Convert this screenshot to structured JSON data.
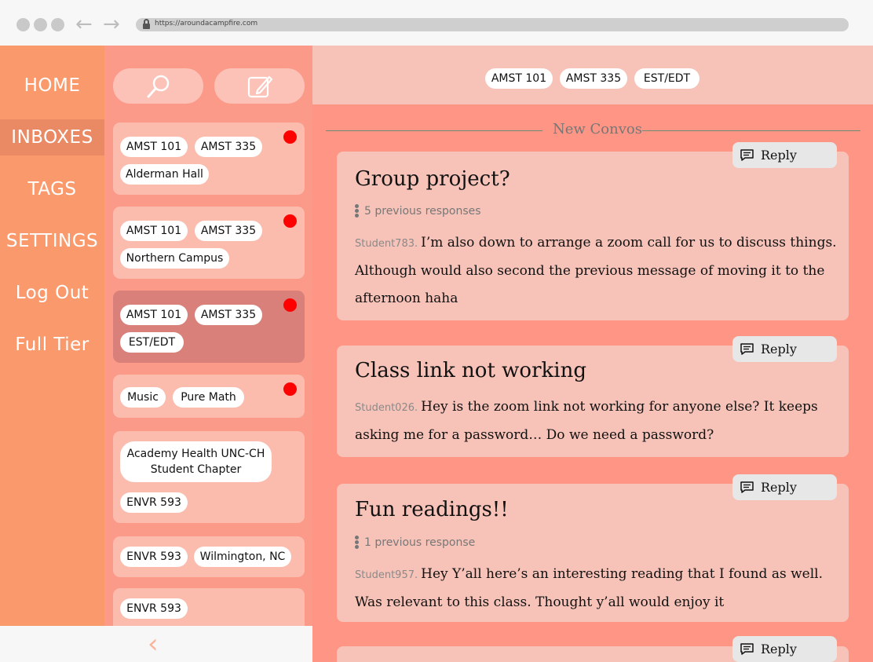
{
  "browser": {
    "url": "https://aroundacampfire.com",
    "back_icon": "arrow-left-icon",
    "forward_icon": "arrow-right-icon"
  },
  "nav": {
    "items": [
      {
        "label": "HOME"
      },
      {
        "label": "INBOXES",
        "active": true
      },
      {
        "label": "TAGS"
      },
      {
        "label": "SETTINGS"
      },
      {
        "label": "Log Out"
      },
      {
        "label": "Full Tier"
      }
    ]
  },
  "inbox_toolbar": {
    "search_icon": "search-icon",
    "compose_icon": "compose-icon"
  },
  "inboxes": [
    {
      "tags": [
        "AMST 101",
        "AMST 335",
        "Alderman Hall"
      ],
      "unread": true
    },
    {
      "tags": [
        "AMST 101",
        "AMST 335",
        "Northern Campus"
      ],
      "unread": true
    },
    {
      "tags": [
        "AMST 101",
        "AMST 335",
        "EST/EDT"
      ],
      "unread": true,
      "selected": true
    },
    {
      "tags": [
        "Music",
        "Pure Math"
      ],
      "unread": true
    },
    {
      "tags": [
        "Academy Health UNC-CH Student Chapter",
        "ENVR 593"
      ],
      "unread": false
    },
    {
      "tags": [
        "ENVR 593",
        "Wilmington, NC"
      ],
      "unread": false
    },
    {
      "tags": [
        "ENVR 593"
      ],
      "unread": false
    }
  ],
  "main": {
    "header_tags": [
      "AMST 101",
      "AMST 335",
      "EST/EDT"
    ],
    "divider_label": "New Convos",
    "reply_label": "Reply",
    "posts": [
      {
        "title": "Group project?",
        "previous": "5 previous responses",
        "author": "Student783.",
        "text": "I’m also down to arrange a zoom call for us to discuss things. Although would also second the previous message of moving it to the afternoon haha"
      },
      {
        "title": "Class link not working",
        "previous": "",
        "author": "Student026.",
        "text": "Hey is the zoom link not working for anyone else? It keeps asking me for a password… Do we need a password?"
      },
      {
        "title": "Fun readings!!",
        "previous": "1 previous response",
        "author": "Student957.",
        "text": "Hey Y’all here’s an interesting reading that I found as well. Was relevant to this class. Thought y’all would enjoy it"
      }
    ]
  },
  "colors": {
    "nav_bg": "#fa9a6c",
    "inbox_bg": "#fb9a89",
    "main_bg": "#fe9585",
    "card_bg": "#fbbcae",
    "unread_dot": "#ff0000"
  }
}
